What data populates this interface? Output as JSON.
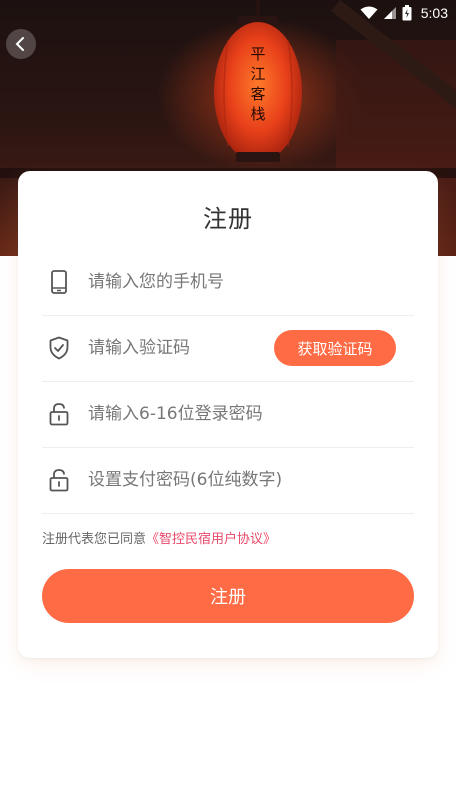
{
  "status_bar": {
    "time": "5:03"
  },
  "hero": {
    "lantern_text": "平江客栈"
  },
  "form": {
    "title": "注册",
    "phone_placeholder": "请输入您的手机号",
    "code_placeholder": "请输入验证码",
    "get_code_label": "获取验证码",
    "password_placeholder": "请输入6-16位登录密码",
    "pay_password_placeholder": "设置支付密码(6位纯数字)",
    "agreement_prefix": "注册代表您已同意",
    "agreement_link": "《智控民宿用户协议》",
    "submit_label": "注册"
  },
  "colors": {
    "accent": "#ff6b45",
    "link": "#e84a6a"
  },
  "icons": {
    "back": "chevron-left-icon",
    "phone": "phone-icon",
    "code": "shield-check-icon",
    "password": "lock-icon",
    "pay_password": "lock-icon"
  }
}
